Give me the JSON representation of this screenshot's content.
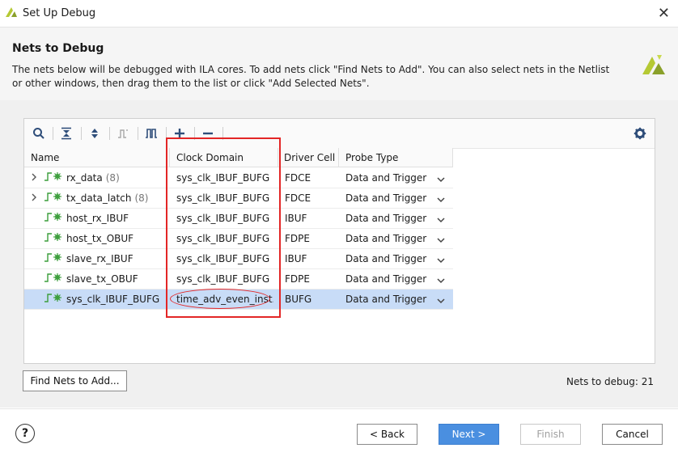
{
  "window": {
    "title": "Set Up Debug",
    "close_label": "✕"
  },
  "header": {
    "title": "Nets to Debug",
    "description": "The nets below will be debugged with ILA cores. To add nets click \"Find Nets to Add\". You can also select nets in the Netlist or other windows, then drag them to the list or click \"Add Selected Nets\"."
  },
  "colors": {
    "accent": "#4a8fe0",
    "selected_row": "#c8dcf7",
    "annotation": "#e32626",
    "net_icon": "#3a9d3a"
  },
  "toolbar": {
    "icons": [
      "search-icon",
      "collapse-all-icon",
      "expand-all-icon",
      "net-waveform-icon",
      "bus-icon",
      "add-icon",
      "remove-icon",
      "gear-icon"
    ]
  },
  "table": {
    "columns": [
      "Name",
      "Clock Domain",
      "Driver Cell",
      "Probe Type"
    ],
    "rows": [
      {
        "name": "rx_data",
        "count": "(8)",
        "clock": "sys_clk_IBUF_BUFG",
        "driver": "FDCE",
        "probe": "Data and Trigger",
        "expandable": true,
        "selected": false
      },
      {
        "name": "tx_data_latch",
        "count": "(8)",
        "clock": "sys_clk_IBUF_BUFG",
        "driver": "FDCE",
        "probe": "Data and Trigger",
        "expandable": true,
        "selected": false
      },
      {
        "name": "host_rx_IBUF",
        "count": "",
        "clock": "sys_clk_IBUF_BUFG",
        "driver": "IBUF",
        "probe": "Data and Trigger",
        "expandable": false,
        "selected": false
      },
      {
        "name": "host_tx_OBUF",
        "count": "",
        "clock": "sys_clk_IBUF_BUFG",
        "driver": "FDPE",
        "probe": "Data and Trigger",
        "expandable": false,
        "selected": false
      },
      {
        "name": "slave_rx_IBUF",
        "count": "",
        "clock": "sys_clk_IBUF_BUFG",
        "driver": "IBUF",
        "probe": "Data and Trigger",
        "expandable": false,
        "selected": false
      },
      {
        "name": "slave_tx_OBUF",
        "count": "",
        "clock": "sys_clk_IBUF_BUFG",
        "driver": "FDPE",
        "probe": "Data and Trigger",
        "expandable": false,
        "selected": false
      },
      {
        "name": "sys_clk_IBUF_BUFG",
        "count": "",
        "clock": "time_adv_even_inst...",
        "driver": "BUFG",
        "probe": "Data and Trigger",
        "expandable": false,
        "selected": true
      }
    ]
  },
  "actions": {
    "find_nets": "Find Nets to Add...",
    "nets_count": "Nets to debug: 21"
  },
  "footer": {
    "help": "?",
    "back": "< Back",
    "next": "Next >",
    "finish": "Finish",
    "cancel": "Cancel"
  }
}
